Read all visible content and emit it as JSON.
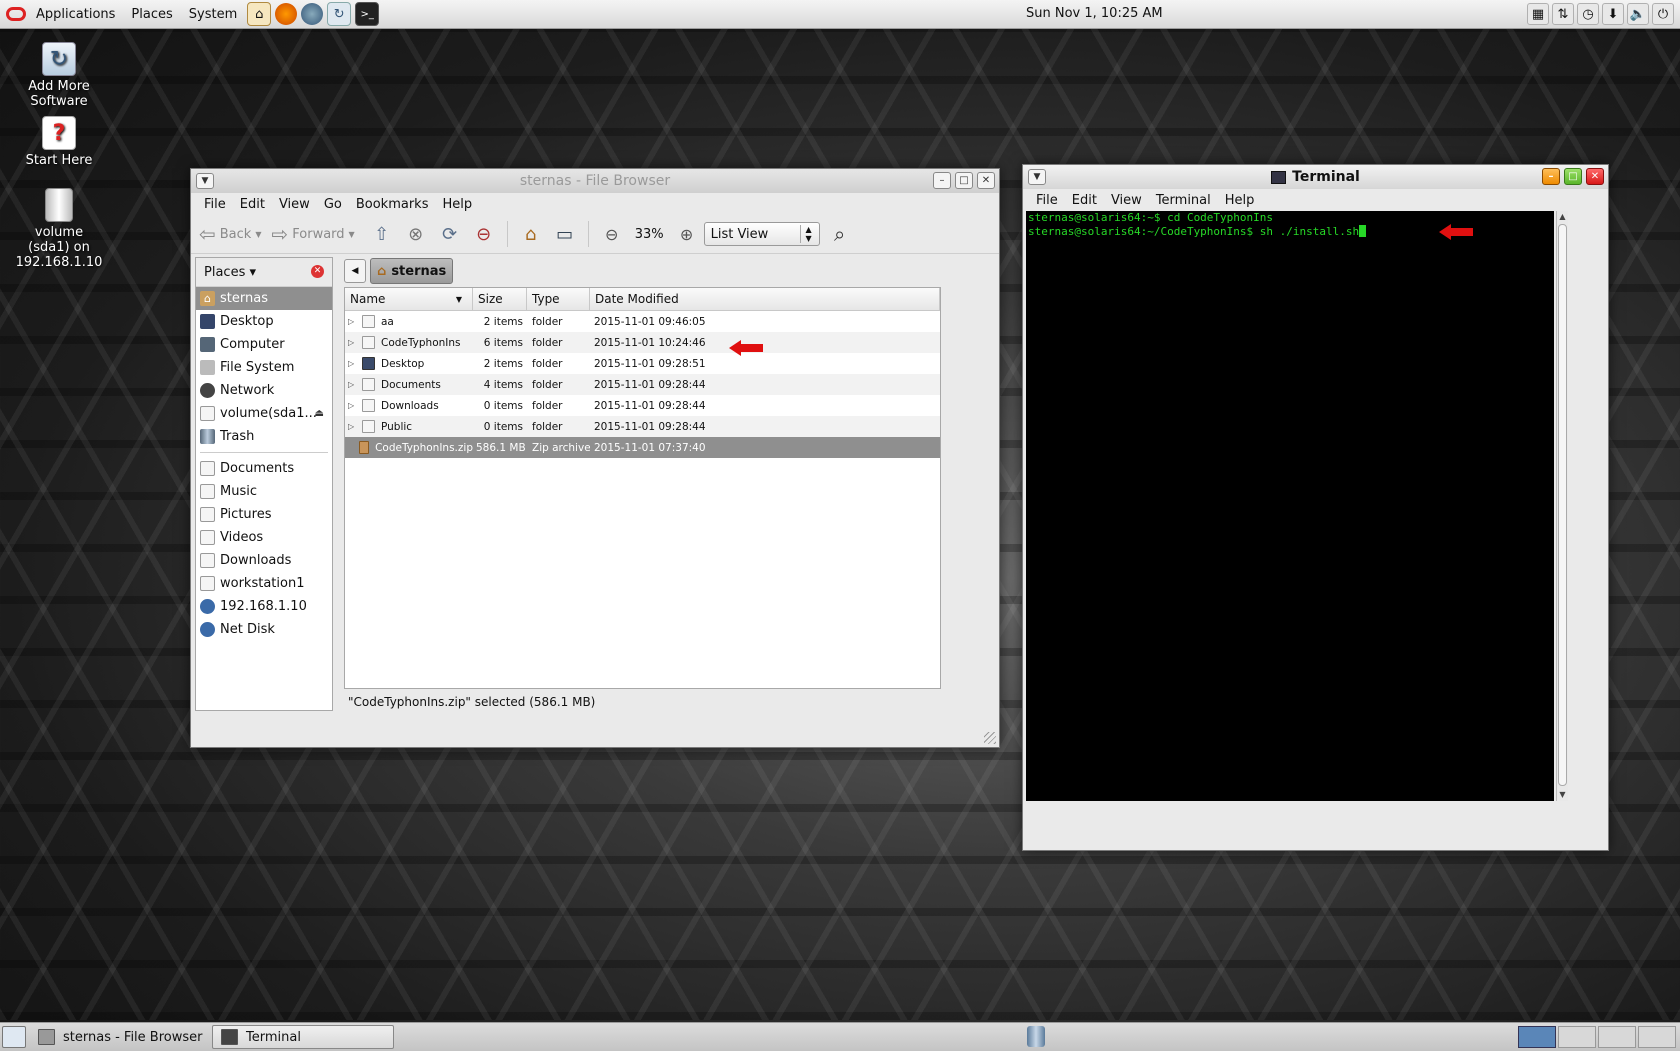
{
  "top_panel": {
    "menus": [
      "Applications",
      "Places",
      "System"
    ],
    "clock": "Sun Nov  1, 10:25 AM"
  },
  "desktop_icons": [
    {
      "label": "Add More Software"
    },
    {
      "label": "Start Here"
    },
    {
      "label": "volume (sda1) on 192.168.1.10"
    }
  ],
  "file_browser": {
    "title": "sternas - File Browser",
    "menus": [
      "File",
      "Edit",
      "View",
      "Go",
      "Bookmarks",
      "Help"
    ],
    "toolbar": {
      "back": "Back",
      "forward": "Forward",
      "zoom": "33%",
      "view_mode": "List View"
    },
    "sidebar": {
      "header": "Places",
      "items": [
        {
          "label": "sternas",
          "selected": true
        },
        {
          "label": "Desktop"
        },
        {
          "label": "Computer"
        },
        {
          "label": "File System"
        },
        {
          "label": "Network"
        },
        {
          "label": "volume(sda1..."
        },
        {
          "label": "Trash"
        }
      ],
      "bookmarks": [
        {
          "label": "Documents"
        },
        {
          "label": "Music"
        },
        {
          "label": "Pictures"
        },
        {
          "label": "Videos"
        },
        {
          "label": "Downloads"
        },
        {
          "label": "workstation1"
        },
        {
          "label": "192.168.1.10"
        },
        {
          "label": "Net Disk"
        }
      ]
    },
    "path": "sternas",
    "columns": [
      "Name",
      "Size",
      "Type",
      "Date Modified"
    ],
    "rows": [
      {
        "name": "aa",
        "size": "2 items",
        "type": "folder",
        "date": "2015-11-01 09:46:05"
      },
      {
        "name": "CodeTyphonIns",
        "size": "6 items",
        "type": "folder",
        "date": "2015-11-01 10:24:46"
      },
      {
        "name": "Desktop",
        "size": "2 items",
        "type": "folder",
        "date": "2015-11-01 09:28:51"
      },
      {
        "name": "Documents",
        "size": "4 items",
        "type": "folder",
        "date": "2015-11-01 09:28:44"
      },
      {
        "name": "Downloads",
        "size": "0 items",
        "type": "folder",
        "date": "2015-11-01 09:28:44"
      },
      {
        "name": "Public",
        "size": "0 items",
        "type": "folder",
        "date": "2015-11-01 09:28:44"
      },
      {
        "name": "CodeTyphonIns.zip",
        "size": "586.1 MB",
        "type": "Zip archive",
        "date": "2015-11-01 07:37:40"
      }
    ],
    "status": "\"CodeTyphonIns.zip\" selected (586.1 MB)"
  },
  "terminal": {
    "title": "Terminal",
    "menus": [
      "File",
      "Edit",
      "View",
      "Terminal",
      "Help"
    ],
    "lines": [
      "sternas@solaris64:~$ cd CodeTyphonIns",
      "sternas@solaris64:~/CodeTyphonIns$ sh ./install.sh"
    ]
  },
  "taskbar": {
    "tasks": [
      {
        "label": "sternas - File Browser"
      },
      {
        "label": "Terminal"
      }
    ]
  },
  "colors": {
    "terminal_text": "#27d827",
    "selection": "#8f8f8f",
    "annotation_arrow": "#e01010"
  }
}
